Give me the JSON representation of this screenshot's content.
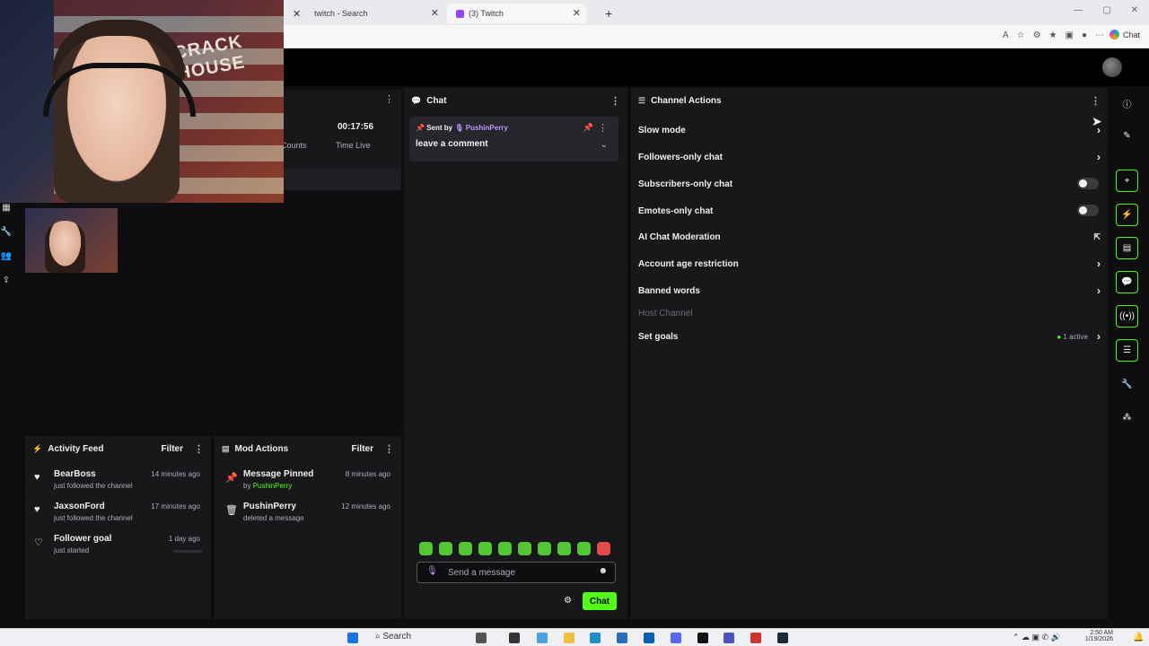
{
  "browser": {
    "tabs": [
      {
        "label": "twitch - Search"
      },
      {
        "label": "(3) Twitch"
      }
    ],
    "copilot_label": "Chat"
  },
  "stats": {
    "counts_label": "Counts",
    "time_value": "00:17:56",
    "time_label": "Time Live"
  },
  "webcam": {
    "sign_text": "CRACK HOUSE"
  },
  "activity": {
    "title": "Activity Feed",
    "filter": "Filter",
    "items": [
      {
        "name": "BearBoss",
        "detail": "just followed the channel",
        "time": "14 minutes ago"
      },
      {
        "name": "JaxsonFord",
        "detail": "just followed the channel",
        "time": "17 minutes ago"
      },
      {
        "name": "Follower goal",
        "detail": "just started",
        "time": "1 day ago"
      }
    ]
  },
  "mod": {
    "title": "Mod Actions",
    "filter": "Filter",
    "items": [
      {
        "name": "Message Pinned",
        "by_prefix": "by",
        "by_user": "PushinPerry",
        "time": "8 minutes ago"
      },
      {
        "name": "PushinPerry",
        "detail": "deleted a message",
        "time": "12 minutes ago"
      }
    ]
  },
  "chat": {
    "title": "Chat",
    "pinned_prefix": "Sent by",
    "pinned_user": "PushinPerry",
    "pinned_text": "leave a comment",
    "placeholder": "Send a message",
    "send_label": "Chat"
  },
  "channel_actions": {
    "title": "Channel Actions",
    "rows": [
      {
        "label": "Slow mode"
      },
      {
        "label": "Followers-only chat"
      },
      {
        "label": "Subscribers-only chat"
      },
      {
        "label": "Emotes-only chat"
      },
      {
        "label": "AI Chat Moderation"
      },
      {
        "label": "Account age restriction"
      },
      {
        "label": "Banned words"
      },
      {
        "label": "Host Channel"
      },
      {
        "label": "Set goals"
      }
    ],
    "goals_badge": "1 active"
  },
  "taskbar": {
    "search_label": "Search",
    "time": "2:50 AM",
    "date": "1/19/2026"
  },
  "colors": {
    "accent": "#53fc18",
    "purple": "#bf94ff",
    "panel": "#18181b"
  }
}
